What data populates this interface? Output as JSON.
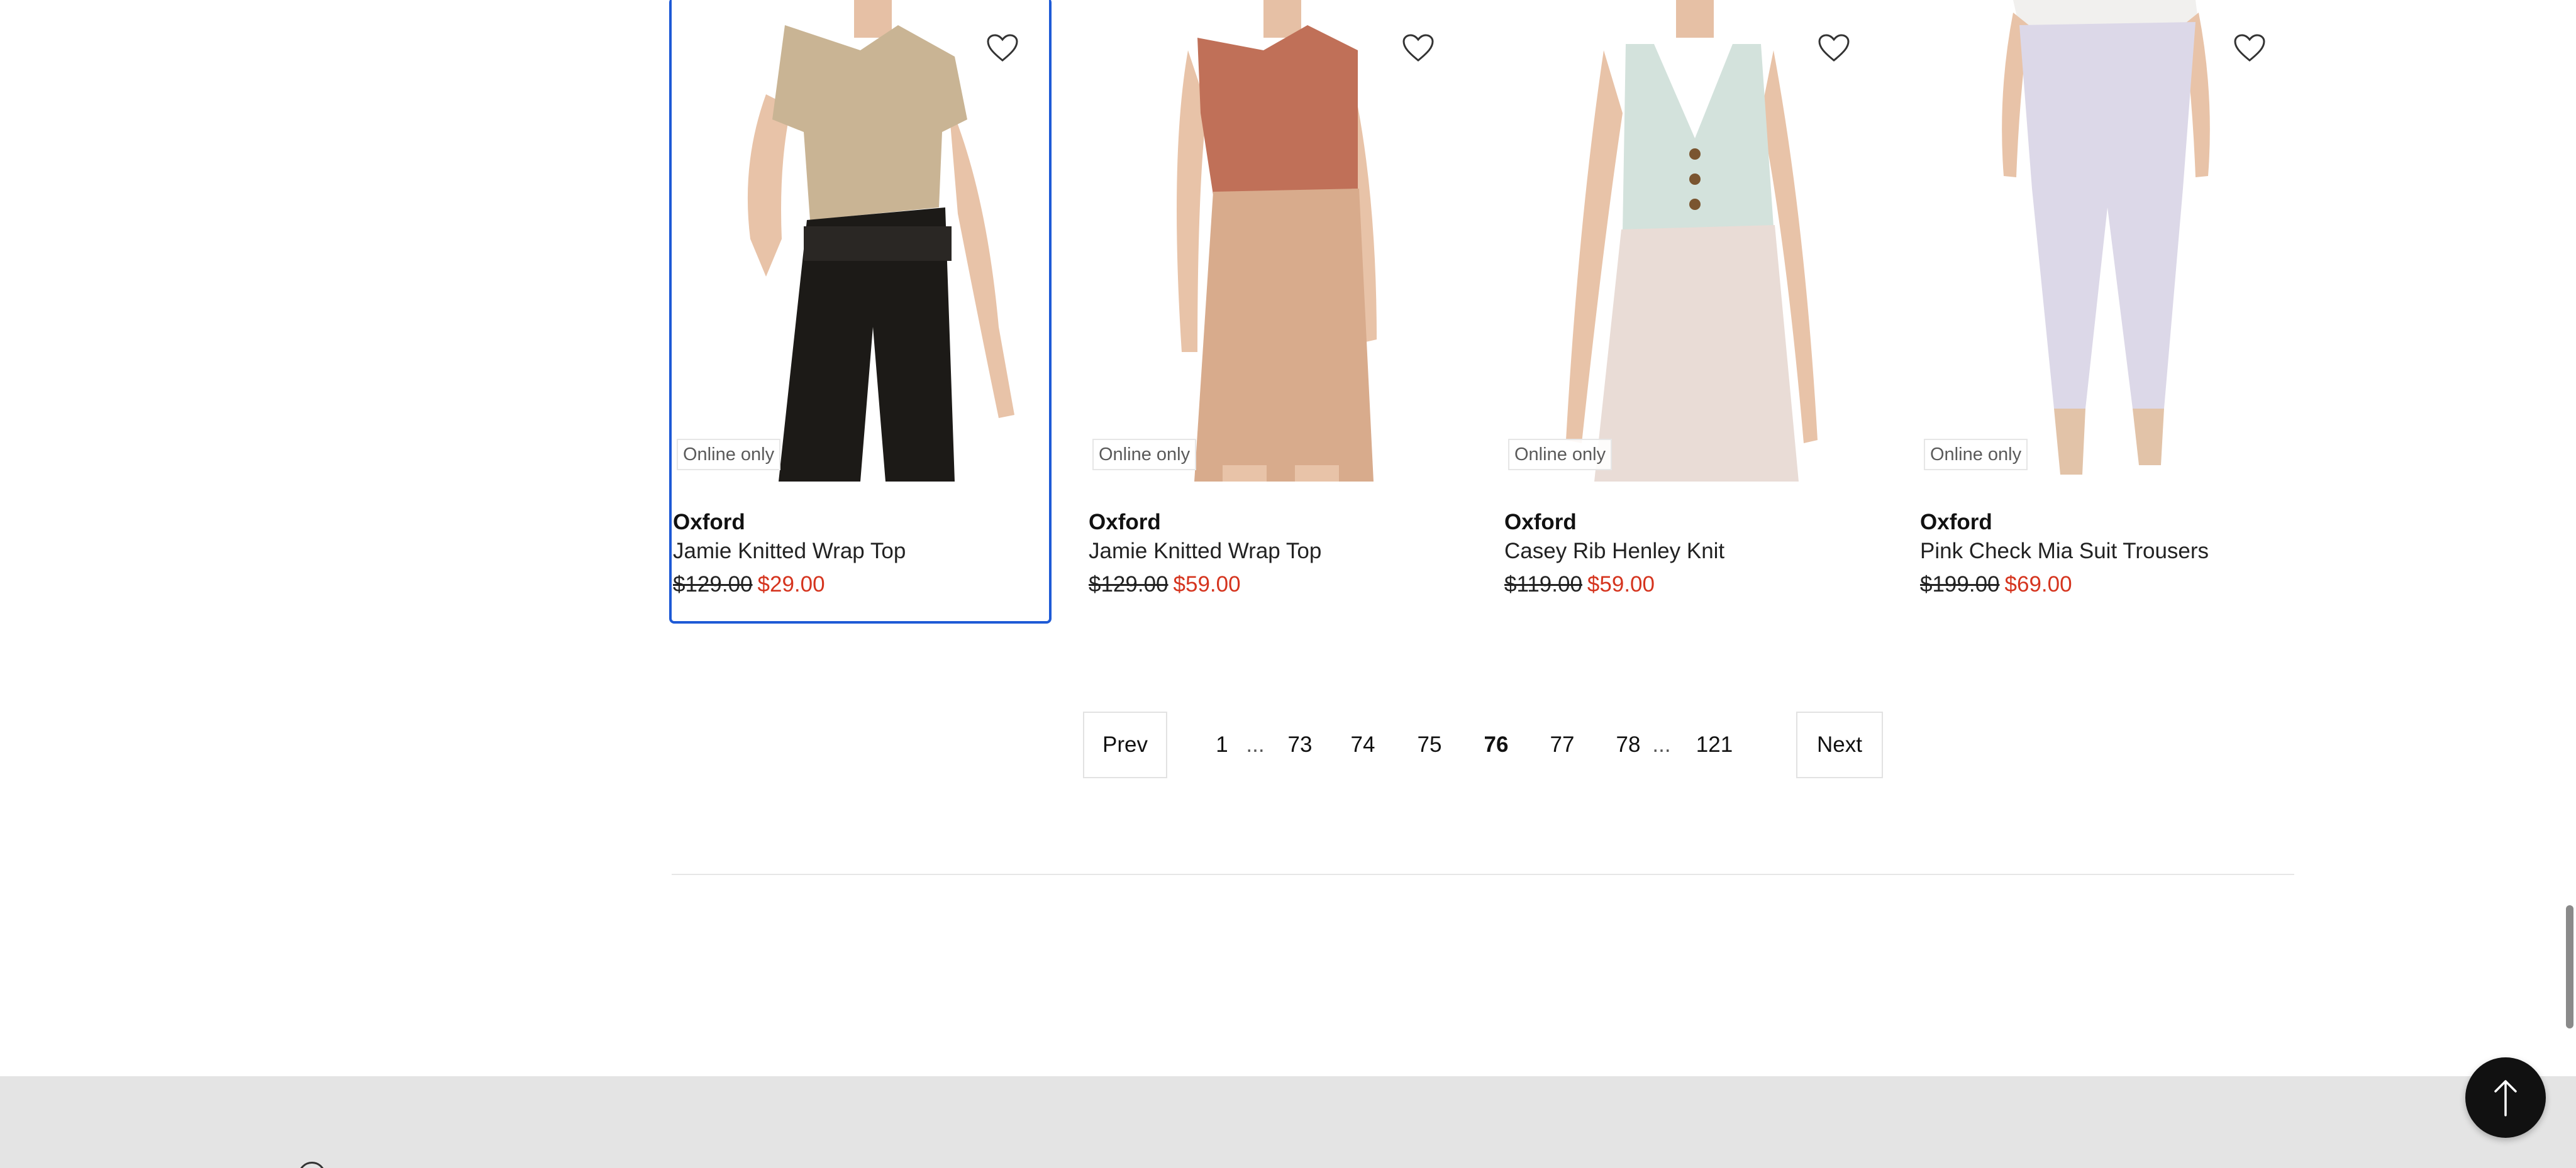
{
  "products": [
    {
      "badge": "Online only",
      "brand": "Oxford",
      "name": "Jamie Knitted Wrap Top",
      "was_price": "$129.00",
      "sale_price": "$29.00",
      "wishlist_icon": "heart-outline-icon",
      "focused": true,
      "top_color": "#c9b494",
      "bottom_color": "#1c1a17"
    },
    {
      "badge": "Online only",
      "brand": "Oxford",
      "name": "Jamie Knitted Wrap Top",
      "was_price": "$129.00",
      "sale_price": "$59.00",
      "wishlist_icon": "heart-outline-icon",
      "focused": false,
      "top_color": "#c07058",
      "bottom_color": "#d8ab8c"
    },
    {
      "badge": "Online only",
      "brand": "Oxford",
      "name": "Casey Rib Henley Knit",
      "was_price": "$119.00",
      "sale_price": "$59.00",
      "wishlist_icon": "heart-outline-icon",
      "focused": false,
      "top_color": "#d3e2dc",
      "bottom_color": "#e9dcd6"
    },
    {
      "badge": "Online only",
      "brand": "Oxford",
      "name": "Pink Check Mia Suit Trousers",
      "was_price": "$199.00",
      "sale_price": "$69.00",
      "wishlist_icon": "heart-outline-icon",
      "focused": false,
      "top_color": "#f1f0ee",
      "bottom_color": "#dcd8e8"
    }
  ],
  "pagination": {
    "prev_label": "Prev",
    "next_label": "Next",
    "pages": [
      "1",
      "73",
      "74",
      "75",
      "76",
      "77",
      "78",
      "121"
    ],
    "ellipsis": "...",
    "current": "76"
  },
  "back_to_top_icon": "arrow-up-icon",
  "colors": {
    "sale_price": "#d5341e",
    "focus_outline": "#1e5ad6",
    "footer_bg": "#e4e4e4"
  }
}
